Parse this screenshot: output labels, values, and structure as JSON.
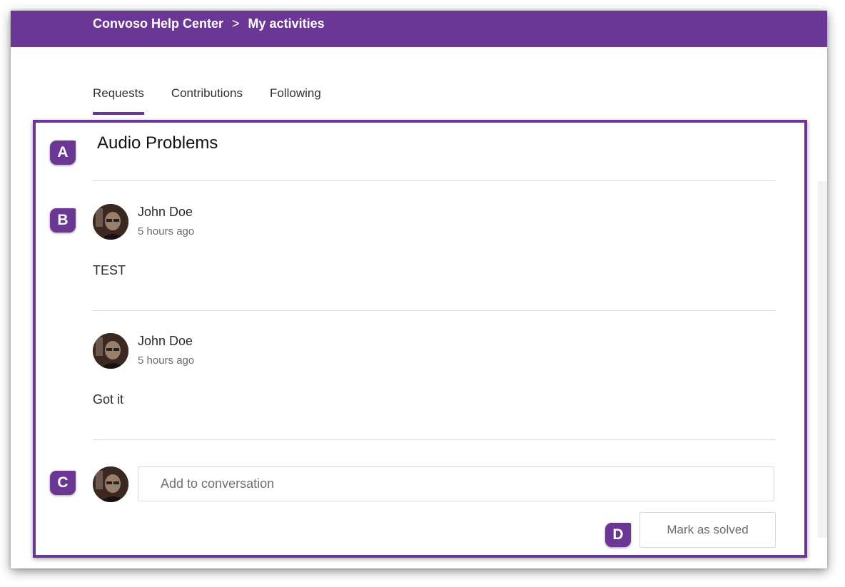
{
  "header": {
    "breadcrumb_root": "Convoso Help Center",
    "breadcrumb_separator": ">",
    "breadcrumb_current": "My activities"
  },
  "tabs": [
    {
      "label": "Requests",
      "active": true
    },
    {
      "label": "Contributions",
      "active": false
    },
    {
      "label": "Following",
      "active": false
    }
  ],
  "request": {
    "title": "Audio Problems"
  },
  "comments": [
    {
      "author": "John Doe",
      "time": "5 hours ago",
      "body": "TEST"
    },
    {
      "author": "John Doe",
      "time": "5 hours ago",
      "body": "Got it"
    }
  ],
  "reply": {
    "placeholder": "Add to conversation"
  },
  "actions": {
    "mark_solved": "Mark as solved"
  },
  "markers": [
    "A",
    "B",
    "C",
    "D"
  ],
  "colors": {
    "brand": "#6b3794"
  }
}
